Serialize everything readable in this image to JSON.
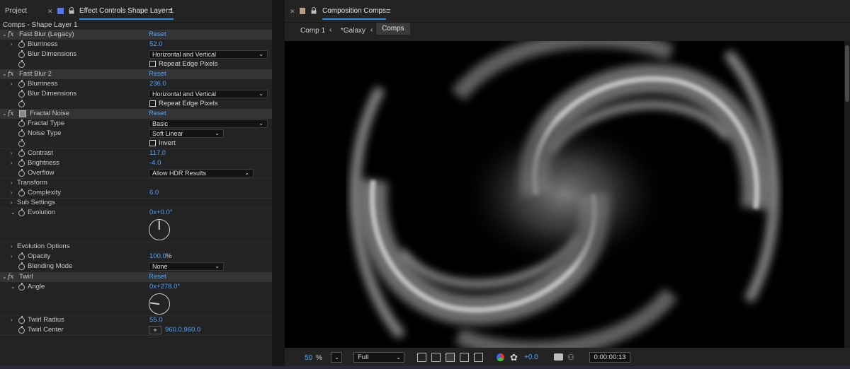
{
  "left_panel": {
    "project_tab": "Project",
    "effect_controls_tab": "Effect Controls Shape Layer 1",
    "layer_title": "Comps - Shape Layer 1",
    "reset_label": "Reset",
    "effects": {
      "fast_blur_legacy": {
        "name": "Fast Blur (Legacy)",
        "blurriness_label": "Blurriness",
        "blurriness_value": "52.0",
        "blur_dimensions_label": "Blur Dimensions",
        "blur_dimensions_value": "Horizontal and Vertical",
        "repeat_edge_label": "Repeat Edge Pixels"
      },
      "fast_blur_2": {
        "name": "Fast Blur 2",
        "blurriness_label": "Blurriness",
        "blurriness_value": "236.0",
        "blur_dimensions_label": "Blur Dimensions",
        "blur_dimensions_value": "Horizontal and Vertical",
        "repeat_edge_label": "Repeat Edge Pixels"
      },
      "fractal_noise": {
        "name": "Fractal Noise",
        "fractal_type_label": "Fractal Type",
        "fractal_type_value": "Basic",
        "noise_type_label": "Noise Type",
        "noise_type_value": "Soft Linear",
        "invert_label": "Invert",
        "contrast_label": "Contrast",
        "contrast_value": "117.0",
        "brightness_label": "Brightness",
        "brightness_value": "-4.0",
        "overflow_label": "Overflow",
        "overflow_value": "Allow HDR Results",
        "transform_label": "Transform",
        "complexity_label": "Complexity",
        "complexity_value": "6.0",
        "sub_settings_label": "Sub Settings",
        "evolution_label": "Evolution",
        "evolution_value": "0x+0.0°",
        "evolution_options_label": "Evolution Options",
        "opacity_label": "Opacity",
        "opacity_value": "100.0",
        "opacity_unit": "%",
        "blending_mode_label": "Blending Mode",
        "blending_mode_value": "None"
      },
      "twirl": {
        "name": "Twirl",
        "angle_label": "Angle",
        "angle_value": "0x+278.0°",
        "twirl_radius_label": "Twirl Radius",
        "twirl_radius_value": "55.0",
        "twirl_center_label": "Twirl Center",
        "twirl_center_value": "960.0,960.0"
      }
    }
  },
  "right_panel": {
    "composition_tab": "Composition Comps",
    "breadcrumbs": [
      "Comp 1",
      "*Galaxy",
      "Comps"
    ],
    "viewer_bar": {
      "zoom": "50",
      "zoom_unit": "%",
      "resolution": "Full",
      "exposure": "+0.0",
      "timecode": "0:00:00:13"
    }
  },
  "colors": {
    "accent_blue": "#4da3ff",
    "tab_underline": "#2d8ceb"
  }
}
